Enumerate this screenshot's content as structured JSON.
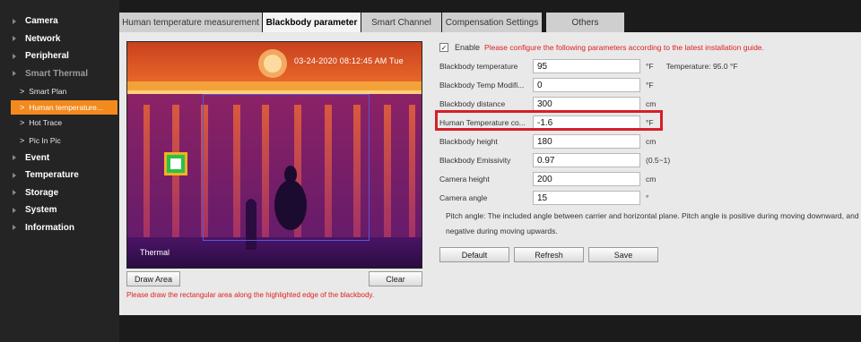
{
  "sidebar": {
    "items": [
      {
        "label": "Camera",
        "type": "top"
      },
      {
        "label": "Network",
        "type": "top"
      },
      {
        "label": "Peripheral",
        "type": "top"
      },
      {
        "label": "Smart Thermal",
        "type": "top-dim"
      },
      {
        "label": "Smart Plan",
        "type": "sub"
      },
      {
        "label": "Human temperature...",
        "type": "sub-active"
      },
      {
        "label": "Hot Trace",
        "type": "sub"
      },
      {
        "label": "Pic In Pic",
        "type": "sub"
      },
      {
        "label": "Event",
        "type": "top"
      },
      {
        "label": "Temperature",
        "type": "top"
      },
      {
        "label": "Storage",
        "type": "top"
      },
      {
        "label": "System",
        "type": "top"
      },
      {
        "label": "Information",
        "type": "top"
      }
    ]
  },
  "tabs": [
    {
      "label": "Human temperature measurement"
    },
    {
      "label": "Blackbody parameter"
    },
    {
      "label": "Smart Channel"
    },
    {
      "label": "Compensation Settings"
    },
    {
      "label": "Others"
    }
  ],
  "preview": {
    "timestamp": "03-24-2020 08:12:45 AM Tue",
    "channel_label": "Thermal"
  },
  "draw_area_button": "Draw Area",
  "clear_button": "Clear",
  "draw_hint": "Please draw the rectangular area along the highlighted edge of the blackbody.",
  "enable": {
    "checked": true,
    "check_glyph": "✓",
    "label": "Enable",
    "note": "Please configure the following parameters according to the latest installation guide."
  },
  "fields": [
    {
      "label": "Blackbody temperature",
      "value": "95",
      "unit": "°F",
      "extra": "Temperature: 95.0 °F"
    },
    {
      "label": "Blackbody Temp Modifi...",
      "value": "0",
      "unit": "°F",
      "extra": ""
    },
    {
      "label": "Blackbody distance",
      "value": "300",
      "unit": "cm",
      "extra": ""
    },
    {
      "label": "Human Temperature co...",
      "value": "-1.6",
      "unit": "°F",
      "extra": ""
    },
    {
      "label": "Blackbody height",
      "value": "180",
      "unit": "cm",
      "extra": ""
    },
    {
      "label": "Blackbody Emissivity",
      "value": "0.97",
      "unit": "(0.5~1)",
      "extra": ""
    },
    {
      "label": "Camera height",
      "value": "200",
      "unit": "cm",
      "extra": ""
    },
    {
      "label": "Camera angle",
      "value": "15",
      "unit": "°",
      "extra": ""
    }
  ],
  "pitch_note": "Pitch angle: The included angle between carrier and horizontal plane. Pitch angle is positive during moving downward, and negative during moving upwards.",
  "actions": {
    "default": "Default",
    "refresh": "Refresh",
    "save": "Save"
  },
  "colors": {
    "accent": "#f28a1e",
    "highlight": "#d61f26",
    "warning_text": "#e02020"
  }
}
